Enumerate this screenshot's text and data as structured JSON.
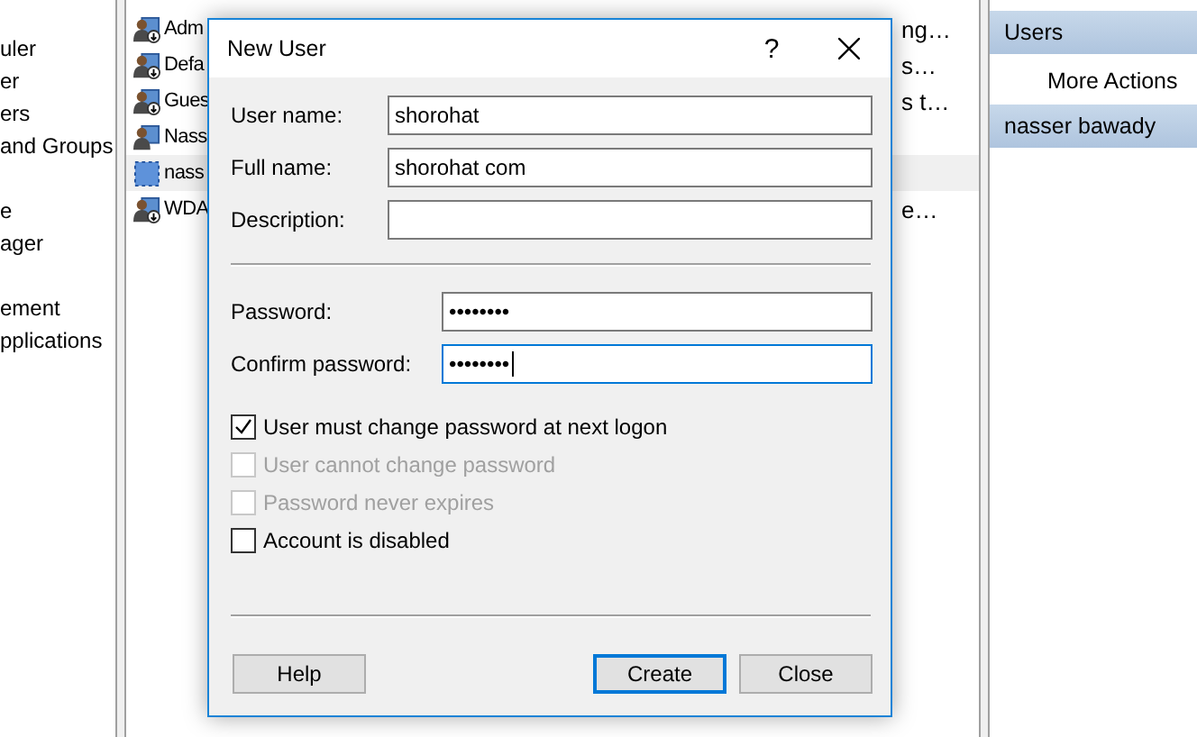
{
  "tree": {
    "groups": [
      {
        "items": [
          {
            "label": "uler"
          },
          {
            "label": "er"
          },
          {
            "label": "ers"
          },
          {
            "label": "and Groups"
          }
        ]
      },
      {
        "items": [
          {
            "label": "e"
          },
          {
            "label": "ager"
          }
        ]
      },
      {
        "items": [
          {
            "label": "ement"
          },
          {
            "label": "pplications"
          }
        ]
      }
    ]
  },
  "user_list": {
    "rows": [
      {
        "name": "Adm",
        "description": "ng…",
        "selected": false,
        "kind": "user"
      },
      {
        "name": "Defa",
        "description": "s…",
        "selected": false,
        "kind": "user"
      },
      {
        "name": "Gues",
        "description": "s t…",
        "selected": false,
        "kind": "user"
      },
      {
        "name": "Nass",
        "selected": false,
        "kind": "admin"
      },
      {
        "name": "nass",
        "selected": true,
        "kind": "new"
      },
      {
        "name": "WDA",
        "description": "e…",
        "selected": false,
        "kind": "user"
      }
    ]
  },
  "actions": {
    "sections": [
      {
        "title": "Users",
        "items": [
          "More Actions"
        ]
      },
      {
        "title": "nasser bawady"
      }
    ]
  },
  "dialog": {
    "title": "New User",
    "help_glyph": "?",
    "fields": [
      {
        "label": "User name:",
        "value": "shorohat",
        "focused": false
      },
      {
        "label": "Full name:",
        "value": "shorohat com",
        "focused": false
      },
      {
        "label": "Description:",
        "focused": false
      }
    ],
    "password_fields": [
      {
        "label": "Password:",
        "value": "••••••••",
        "focused": false
      },
      {
        "label": "Confirm password:",
        "value": "••••••••",
        "focused": true
      }
    ],
    "options": [
      {
        "label": "User must change password at next logon",
        "checked": true,
        "disabled": false
      },
      {
        "label": "User cannot change password",
        "checked": false,
        "disabled": true
      },
      {
        "label": "Password never expires",
        "checked": false,
        "disabled": true
      },
      {
        "label": "Account is disabled",
        "checked": false,
        "disabled": false
      }
    ],
    "buttons": [
      {
        "label": "Help",
        "default": false
      },
      {
        "label": "Create",
        "default": true
      },
      {
        "label": "Close",
        "default": false
      }
    ]
  }
}
